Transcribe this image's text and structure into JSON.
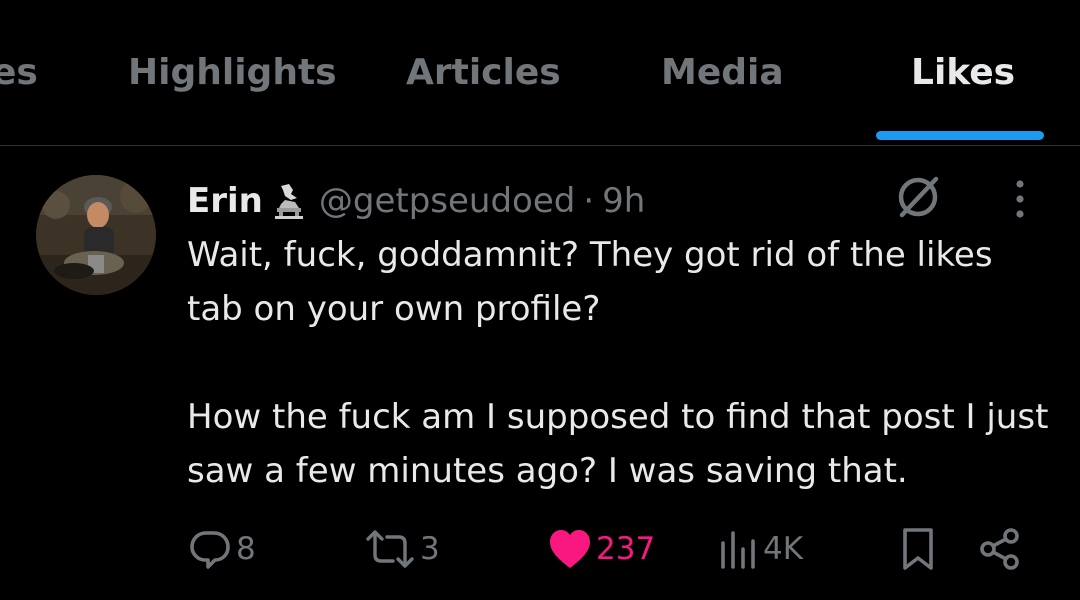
{
  "tabs": [
    {
      "label": "es",
      "active": false
    },
    {
      "label": "Highlights",
      "active": false
    },
    {
      "label": "Articles",
      "active": false
    },
    {
      "label": "Media",
      "active": false
    },
    {
      "label": "Likes",
      "active": true
    }
  ],
  "tweet": {
    "display_name": "Erin",
    "badge_icon": "statue-emoji-icon",
    "handle": "@getpseudoed",
    "separator": "·",
    "time": "9h",
    "text_line1": "Wait, fuck, goddamnit? They got rid of the likes tab on your own profile?",
    "text_line2": "How the fuck am I supposed to find that post I just saw a few minutes ago? I was saving that.",
    "actions": {
      "replies": "8",
      "reposts": "3",
      "likes": "237",
      "views": "4K"
    }
  },
  "colors": {
    "background": "#000000",
    "text": "#e7e9ea",
    "muted": "#71767b",
    "accent": "#1d9bf0",
    "like": "#f91880",
    "divider": "#2f3336"
  }
}
